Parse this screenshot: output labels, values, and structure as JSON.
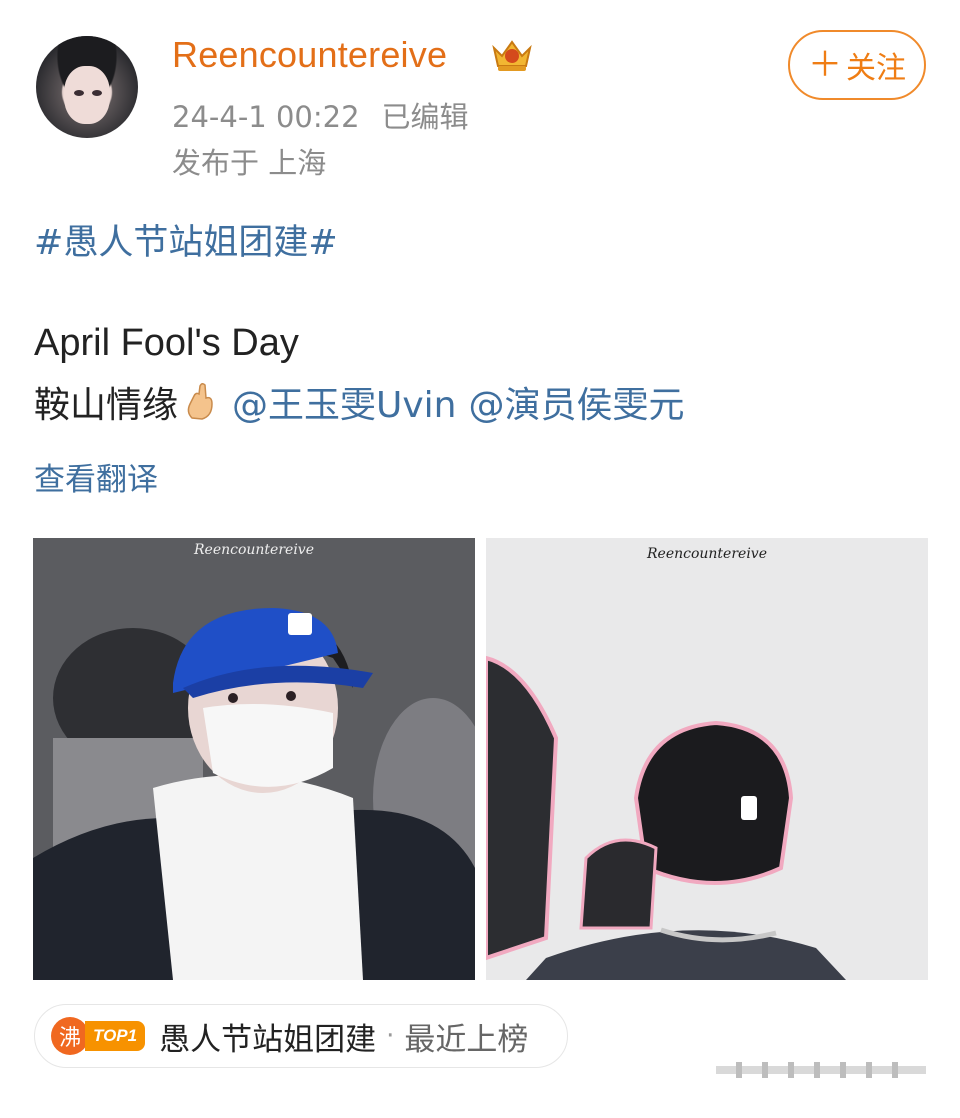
{
  "post": {
    "username": "Reencountereive",
    "date": "24-4-1 00:22",
    "edited": "已编辑",
    "location": "发布于 上海",
    "follow_label": "关注",
    "topic": "#愚人节站姐团建#",
    "line1": "April Fool's Day",
    "line2_text": "鞍山情缘",
    "mention1": "@王玉雯Uvin",
    "mention2": "@演员侯雯元",
    "translate": "查看翻译",
    "watermark": "Reencountereive"
  },
  "hot": {
    "icon_label": "沸",
    "badge": "TOP1",
    "title": "愚人节站姐团建",
    "separator": "·",
    "status": "最近上榜"
  },
  "icons": [
    "avatar",
    "vip-crown-icon",
    "plus-icon",
    "crossed-fingers-emoji",
    "hot-icon",
    "top-badge"
  ],
  "colors": {
    "username": "#e36f18",
    "link": "#3f6f9f",
    "follow": "#ef7d14",
    "hot_icon": "#f06820",
    "top_badge": "#f79200"
  }
}
